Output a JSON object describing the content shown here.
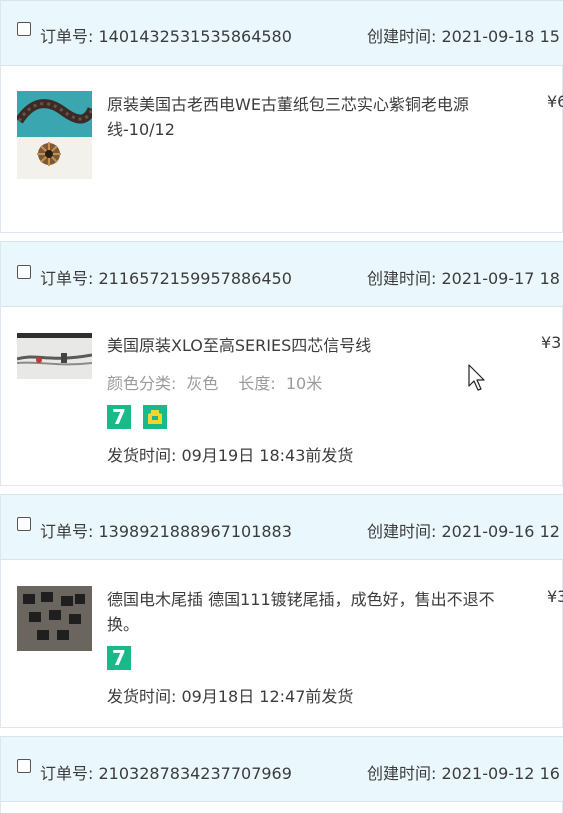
{
  "labels": {
    "order_no": "订单号:",
    "created": "创建时间:",
    "ship_prefix": "发货时间:"
  },
  "orders": [
    {
      "order_no": "1401432531535864580",
      "created_time": "2021-09-18 15",
      "item_title": "原装美国古老西电WE古董纸包三芯实心紫铜老电源线-10/12",
      "price": "¥6"
    },
    {
      "order_no": "2116572159957886450",
      "created_time": "2021-09-17 18",
      "item_title": "美国原装XLO至高SERIES四芯信号线",
      "sku": [
        {
          "label": "颜色分类:",
          "value": "灰色"
        },
        {
          "label": "长度:",
          "value": "10米"
        }
      ],
      "badges": [
        "seven-day-return-icon",
        "guarantee-shield-icon"
      ],
      "seven_label": "7",
      "ship_time": "09月19日 18:43前发货",
      "price": "¥3"
    },
    {
      "order_no": "1398921888967101883",
      "created_time": "2021-09-16 12",
      "item_title": "德国电木尾插 德国111镀铑尾插，成色好，售出不退不换。",
      "badges": [
        "seven-day-return-icon"
      ],
      "seven_label": "7",
      "ship_time": "09月18日 12:47前发货",
      "price": "¥3"
    },
    {
      "order_no": "2103287834237707969",
      "created_time": "2021-09-12 16"
    }
  ],
  "colors": {
    "header_bg": "#eaf8fe",
    "badge_green": "#19b98a",
    "sku_gray": "#9b9b9b"
  }
}
